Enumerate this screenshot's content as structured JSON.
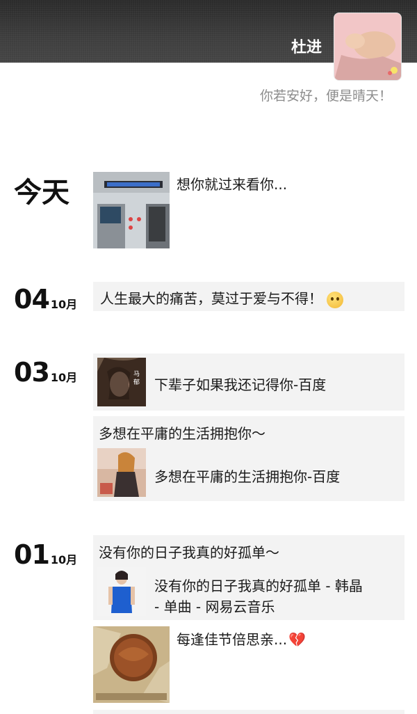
{
  "profile": {
    "username": "杜进",
    "signature": "你若安好，便是晴天！"
  },
  "posts": {
    "today": {
      "label": "今天",
      "caption": "想你就过来看你..."
    },
    "d04": {
      "day": "04",
      "month": "10月",
      "text": "人生最大的痛苦，莫过于爱与不得！"
    },
    "d03": {
      "day": "03",
      "month": "10月",
      "share1_title": "下辈子如果我还记得你-百度",
      "post2_text": "多想在平庸的生活拥抱你～",
      "share2_title": "多想在平庸的生活拥抱你-百度"
    },
    "d01": {
      "day": "01",
      "month": "10月",
      "post1_text": "没有你的日子我真的好孤单～",
      "share_line1": "没有你的日子我真的好孤单 - 韩晶",
      "share_line2": "- 单曲 - 网易云音乐",
      "post2_caption": "每逢佳节倍思亲..."
    }
  },
  "icons": {
    "emoji": "pleading-face-icon",
    "heart": "broken-heart-icon"
  }
}
